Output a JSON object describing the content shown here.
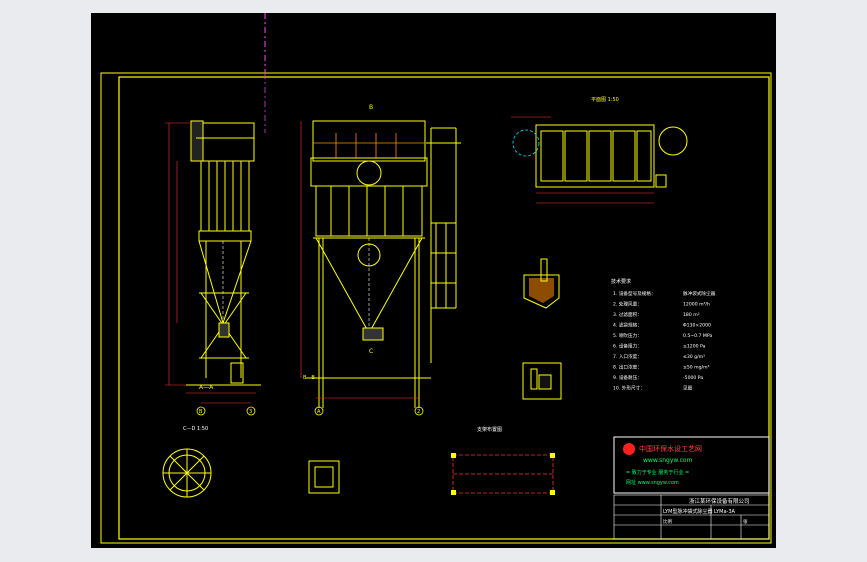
{
  "drawing": {
    "colors": {
      "background": "#000000",
      "frame": "#ffff00",
      "lines": "#ffff00",
      "dims": "#ff3030",
      "notes": "#ffffff",
      "hatch": "#ff8c00",
      "logo_green": "#00ff66",
      "logo_red": "#ff2020",
      "center": "#ff40ff"
    },
    "view_labels": {
      "top_mark": "B",
      "section_a": "A—A",
      "section_b": "B—B",
      "side_plan": "平面图 1:50",
      "view_c": "C",
      "detail_cd": "C—D 1:50",
      "grid_b": "B",
      "grid_a": "A",
      "grid_3": "3",
      "grid_2": "2",
      "hatch_label": "支架布置图"
    },
    "notes_title": "技术要求",
    "notes": [
      "1. 设备型号及规格：",
      "2. 处理风量：",
      "3. 过滤面积：",
      "4. 滤袋规格：",
      "5. 喷吹压力：",
      "6. 设备阻力：",
      "7. 入口浓度：",
      "8. 出口浓度：",
      "9. 设备耐压：",
      "10. 外形尺寸："
    ],
    "notes_values": [
      "脉冲袋式除尘器",
      "12000 m³/h",
      "180 m²",
      "Φ130×2000",
      "0.5~0.7 MPa",
      "≤1200 Pa",
      "≤30 g/m³",
      "≤50 mg/m³",
      "-5000 Pa",
      "见图"
    ],
    "logo": {
      "title": "中国环保水设工艺网",
      "url": "www.sngyw.com",
      "slogan": "= 致力于专业 服务于行业 =",
      "contact": "网址 www.sngyw.com"
    },
    "title_block": {
      "company": "浙江某环保设备有限公司",
      "drawing_name": "LYM型脉冲袋式除尘器",
      "drawing_no": "LYMa-3A",
      "scale_label": "比例",
      "sheet_label": "张"
    }
  }
}
